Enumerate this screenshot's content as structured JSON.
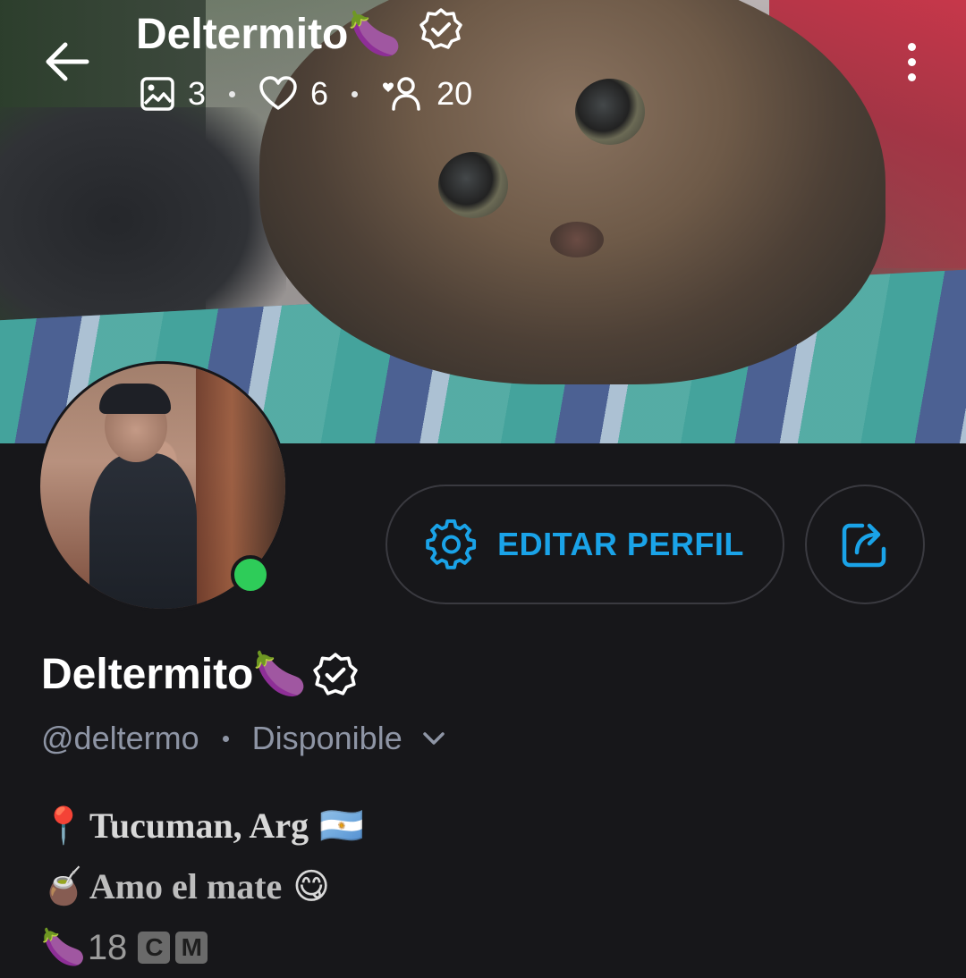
{
  "header": {
    "title": "Deltermito🍆",
    "stats": {
      "posts": "3",
      "likes": "6",
      "followers": "20"
    }
  },
  "profile": {
    "display_name": "Deltermito🍆",
    "handle": "@deltermo",
    "status": "Disponible",
    "edit_button_label": "EDITAR PERFIL"
  },
  "bio": {
    "line1_emoji": "📍",
    "line1_text": "Tucuman, Arg",
    "line1_flag": "🇦🇷",
    "line2_emoji": "🧉",
    "line2_text": "Amo el mate",
    "line2_face": "😋",
    "line3_emoji": "🍆",
    "line3_number": "18",
    "line3_letter1": "C",
    "line3_letter2": "M"
  },
  "colors": {
    "accent": "#1aa3e8",
    "background": "#17171a",
    "online": "#2ecc59",
    "muted_text": "#8e95a5"
  },
  "icons": [
    "arrow-left-icon",
    "image-icon",
    "heart-icon",
    "followers-icon",
    "more-vertical-icon",
    "verified-badge-icon",
    "gear-icon",
    "share-icon",
    "chevron-down-icon"
  ]
}
